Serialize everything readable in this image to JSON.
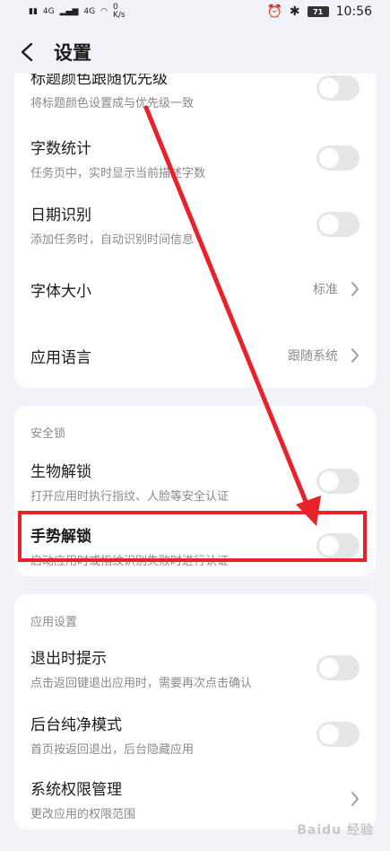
{
  "status_bar": {
    "network_speed": "0\nK/s",
    "signal_1": "4G",
    "signal_2": "4G",
    "battery": "71",
    "time": "10:56"
  },
  "header": {
    "title": "设置"
  },
  "card1": {
    "rows": [
      {
        "title": "标题颜色跟随优先级",
        "subtitle": "将标题颜色设置成与优先级一致"
      },
      {
        "title": "字数统计",
        "subtitle": "任务页中，实时显示当前描述字数"
      },
      {
        "title": "日期识别",
        "subtitle": "添加任务时，自动识别时间信息"
      },
      {
        "title": "字体大小",
        "value": "标准"
      },
      {
        "title": "应用语言",
        "value": "跟随系统"
      }
    ]
  },
  "card2": {
    "section": "安全锁",
    "rows": [
      {
        "title": "生物解锁",
        "subtitle": "打开应用时执行指纹、人脸等安全认证"
      },
      {
        "title": "手势解锁",
        "subtitle": "启动应用时或指纹识别失败时进行认证"
      }
    ]
  },
  "card3": {
    "section": "应用设置",
    "rows": [
      {
        "title": "退出时提示",
        "subtitle": "点击返回键退出应用时，需要再次点击确认"
      },
      {
        "title": "后台纯净模式",
        "subtitle": "首页按返回退出，后台隐藏应用"
      },
      {
        "title": "系统权限管理",
        "subtitle": "更改应用的权限范围"
      }
    ]
  },
  "watermark": "Baidu 经验",
  "colors": {
    "annotation": "#e8222b",
    "toggle_off": "#e6e6e6",
    "background": "#f1f3f8"
  }
}
